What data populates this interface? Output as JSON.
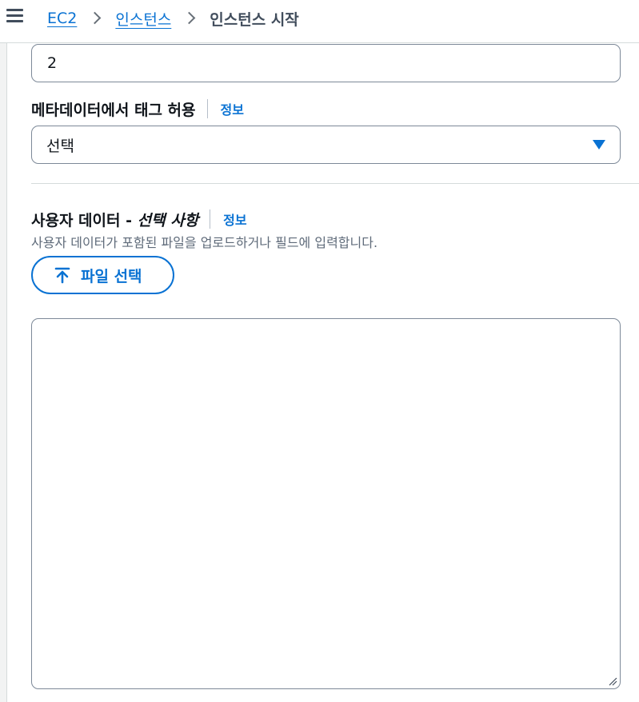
{
  "header": {
    "menu_icon": "hamburger-menu-icon",
    "breadcrumbs": [
      {
        "label": "EC2"
      },
      {
        "label": "인스턴스"
      },
      {
        "label": "인스턴스 시작"
      }
    ],
    "separator_icon": "chevron-right-icon"
  },
  "fields": {
    "quantity_value": "2",
    "metadata_tags": {
      "label": "메타데이터에서 태그 허용",
      "info": "정보",
      "selected": "선택",
      "dropdown_icon": "caret-down-icon"
    },
    "user_data": {
      "label": "사용자 데이터 - ",
      "label_optional": "선택 사항",
      "info": "정보",
      "description": "사용자 데이터가 포함된 파일을 업로드하거나 필드에 입력합니다.",
      "file_button": "파일 선택",
      "upload_icon": "upload-arrow-icon",
      "textarea_value": ""
    }
  },
  "colors": {
    "accent": "#0972d3",
    "text": "#0f141a",
    "muted": "#5f6b7a",
    "border": "#7d8998"
  }
}
